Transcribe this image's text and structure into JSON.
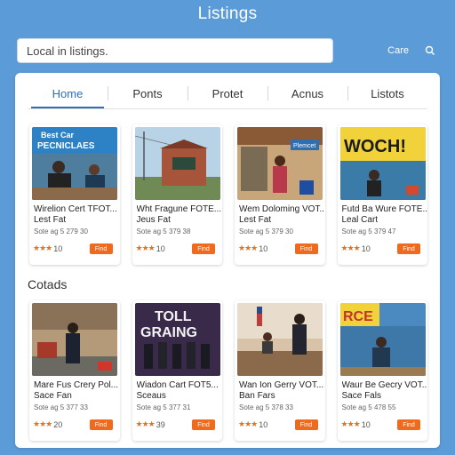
{
  "app": {
    "title": "Listings"
  },
  "search": {
    "value": "Local in listings."
  },
  "header": {
    "link_label": "Care"
  },
  "tabs": [
    "Home",
    "Ponts",
    "Protet",
    "Acnus",
    "Listots"
  ],
  "sections": {
    "second_label": "Cotads"
  },
  "colors": {
    "background": "#5b9bd8",
    "accent": "#2f6fb7",
    "button": "#ef6a1c",
    "star": "#e2731f"
  },
  "row1": [
    {
      "thumb_text": "Best Car\nPECNICLAES",
      "title": "Wirelion Cert TFOT...",
      "subtitle": "Lest Fat",
      "meta": "Sote ag 5 279 30",
      "rating": "10",
      "stars": "★★★",
      "button": "Find"
    },
    {
      "thumb_text": "",
      "title": "Wht Fragune FOTE...",
      "subtitle": "Jeus Fat",
      "meta": "Sote ag 5 379 38",
      "rating": "10",
      "stars": "★★★",
      "button": "Find"
    },
    {
      "thumb_text": "Plemcet",
      "title": "Wem Doloming VOT...",
      "subtitle": "Lest Fat",
      "meta": "Sote ag 5 379 30",
      "rating": "10",
      "stars": "★★★",
      "button": "Find"
    },
    {
      "thumb_text": "WOCH!",
      "title": "Futd Ba Wure FOTE...",
      "subtitle": "Leal Cart",
      "meta": "Sote ag 5 379 47",
      "rating": "10",
      "stars": "★★★",
      "button": "Find"
    }
  ],
  "row2": [
    {
      "thumb_text": "",
      "title": "Mare Fus Crery Pol...",
      "subtitle": "Sace Fan",
      "meta": "Sote ag 5 377 33",
      "rating": "20",
      "stars": "★★★",
      "button": "Find"
    },
    {
      "thumb_text": "TOLL\nGRAING",
      "title": "Wiadon Cart FOT5...",
      "subtitle": "Sceaus",
      "meta": "Sote ag 5 377 31",
      "rating": "39",
      "stars": "★★★",
      "button": "Find"
    },
    {
      "thumb_text": "",
      "title": "Wan Ion Gerry VOT...",
      "subtitle": "Ban Fars",
      "meta": "Sote ag 5 378 33",
      "rating": "10",
      "stars": "★★★",
      "button": "Find"
    },
    {
      "thumb_text": "RCE",
      "title": "Waur Be Gecry VOT...",
      "subtitle": "Sace Fals",
      "meta": "Sote ag 5 478 55",
      "rating": "10",
      "stars": "★★★",
      "button": "Find"
    }
  ]
}
